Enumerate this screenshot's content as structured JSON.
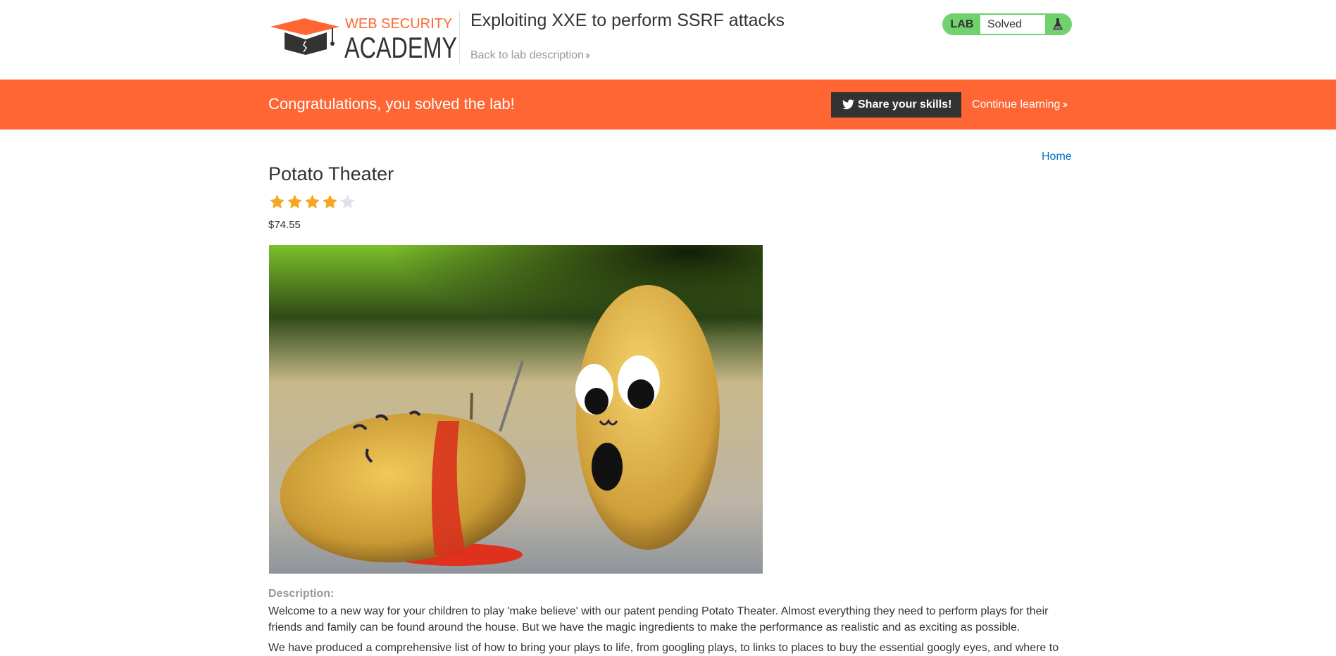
{
  "header": {
    "logo": {
      "line1": "WEB SECURITY",
      "line2": "ACADEMY"
    },
    "lab_title": "Exploiting XXE to perform SSRF attacks",
    "back_link": "Back to lab description",
    "lab_status": {
      "label": "LAB",
      "value": "Solved",
      "icon": "flask-icon"
    }
  },
  "banner": {
    "message": "Congratulations, you solved the lab!",
    "share_button": "Share your skills!",
    "continue_link": "Continue learning"
  },
  "nav": {
    "home": "Home"
  },
  "product": {
    "title": "Potato Theater",
    "rating": 4,
    "rating_max": 5,
    "price": "$74.55",
    "image_alt": "potato-theater-image"
  },
  "description": {
    "label": "Description:",
    "paragraph1": "Welcome to a new way for your children to play 'make believe' with our patent pending Potato Theater. Almost everything they need to perform plays for their friends and family can be found around the house. But we have the magic ingredients to make the performance as realistic and as exciting as possible.",
    "paragraph2": "We have produced a comprehensive list of how to bring your plays to life, from googling plays, to links to places to buy the essential googly eyes, and where to"
  },
  "colors": {
    "brand_orange": "#ff6633",
    "lab_green": "#70d16d",
    "link_blue": "#0071bc",
    "star_filled": "#f5a623",
    "star_empty": "#dfe4ea"
  }
}
